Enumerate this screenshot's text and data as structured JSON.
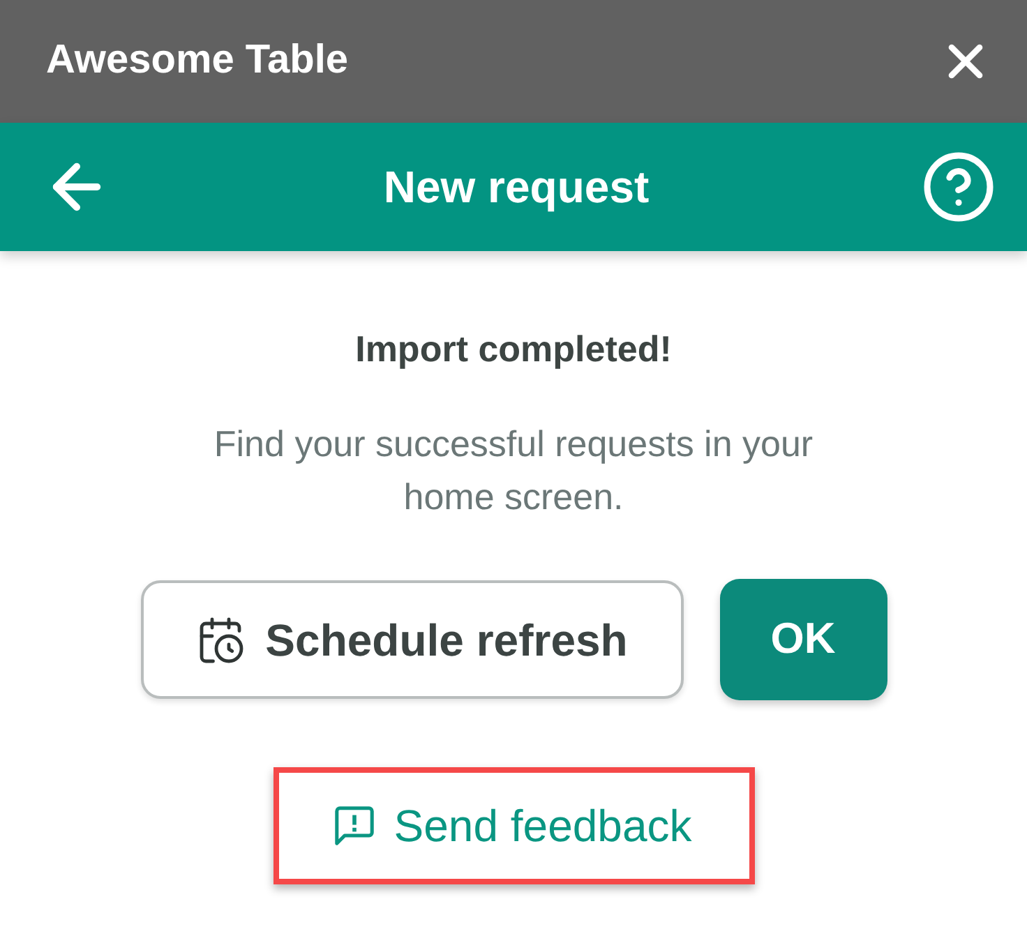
{
  "window": {
    "title": "Awesome Table"
  },
  "header": {
    "title": "New request"
  },
  "message": {
    "title": "Import completed!",
    "description": "Find your successful requests in your home screen."
  },
  "actions": [
    {
      "kind": "schedule",
      "label": "Schedule refresh"
    },
    {
      "kind": "confirm",
      "label": "OK"
    }
  ],
  "feedback": {
    "label": "Send feedback",
    "highlighted": true
  }
}
